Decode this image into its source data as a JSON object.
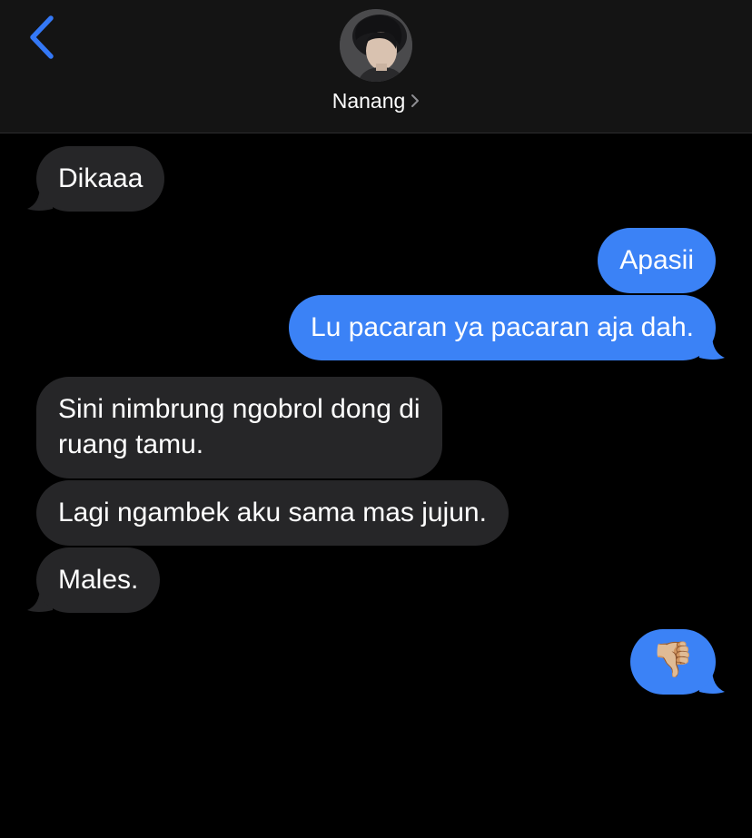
{
  "header": {
    "back_icon": "chevron-left-icon",
    "contact_name": "Nanang",
    "accent_color": "#3478f6"
  },
  "messages": [
    {
      "direction": "incoming",
      "text": "Dikaaa"
    },
    {
      "direction": "outgoing",
      "text": "Apasii"
    },
    {
      "direction": "outgoing",
      "text": "Lu pacaran ya pacaran aja dah."
    },
    {
      "direction": "incoming",
      "lines": [
        "Sini nimbrung ngobrol dong di",
        "ruang tamu."
      ]
    },
    {
      "direction": "incoming",
      "text": "Lagi ngambek aku sama mas jujun."
    },
    {
      "direction": "incoming",
      "text": "Males."
    },
    {
      "direction": "outgoing",
      "text": "👎🏼",
      "icon": "thumbs-down-icon"
    }
  ],
  "colors": {
    "incoming_bubble": "#262628",
    "outgoing_bubble": "#3b82f6",
    "background": "#000000",
    "header": "#141414"
  }
}
